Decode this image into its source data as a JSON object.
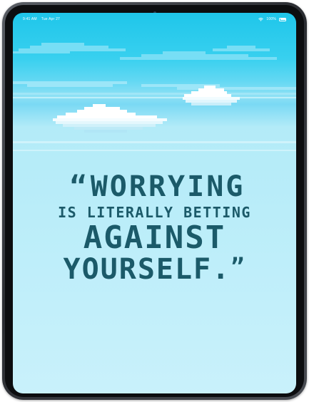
{
  "status_bar": {
    "time": "9:41 AM",
    "date": "Tue Apr 27",
    "battery": "100%"
  },
  "quote": {
    "open_mark": "“",
    "line_1": "Worrying",
    "line_2": "is literally betting",
    "line_3": "against",
    "line_4": "yourself.",
    "close_mark": "”"
  },
  "colors": {
    "text": "#1b5a69",
    "sky_top": "#1fc6ea",
    "sky_bottom": "#c9f1fb",
    "device_frame": "#2a2c31"
  },
  "icons": [
    "wifi-icon",
    "battery-icon",
    "camera-icon"
  ]
}
